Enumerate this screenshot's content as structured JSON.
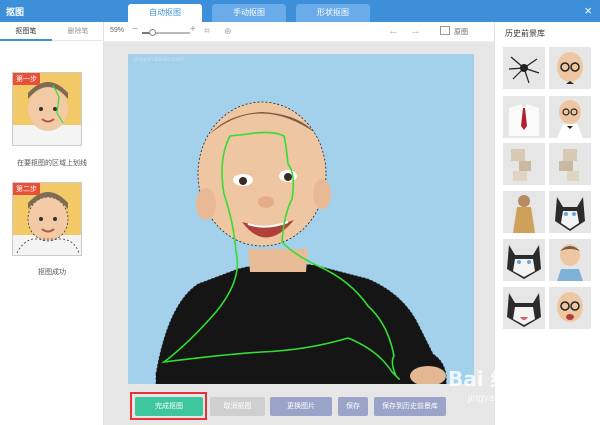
{
  "app": {
    "title": "抠图",
    "tabs": [
      "自动抠图",
      "手动抠图",
      "形状抠图"
    ]
  },
  "left_panel": {
    "tabs": [
      "抠图笔",
      "删除笔"
    ],
    "steps": [
      {
        "badge": "第一步",
        "caption": "在要抠图的区域上划线"
      },
      {
        "badge": "第二步",
        "caption": "抠图成功"
      }
    ]
  },
  "toolbar": {
    "zoom_label": "59%",
    "zoom_level": 0.2,
    "original_label": "原图",
    "icons": [
      "zoom-minus-icon",
      "zoom-plus-icon",
      "crop-icon",
      "magnify-icon",
      "undo-icon",
      "redo-icon",
      "original-image-icon"
    ]
  },
  "canvas": {
    "watermark": "jingyan.baidu.com/",
    "background": "#a3d1eb",
    "stroke_color": "#33dd33"
  },
  "buttons": {
    "finish": "完成抠图",
    "cancel": "取消抠图",
    "replace": "更换图片",
    "save": "保存",
    "save_history": "保存到历史前景库"
  },
  "right_panel": {
    "title": "历史前景库"
  },
  "baidu_mark": {
    "brand": "Bai 经验",
    "url": "jingyan.baidu.com"
  },
  "colors": {
    "titlebar": "#3d8fd9",
    "finish_button": "#3ec79c",
    "highlight": "#e8333a"
  }
}
